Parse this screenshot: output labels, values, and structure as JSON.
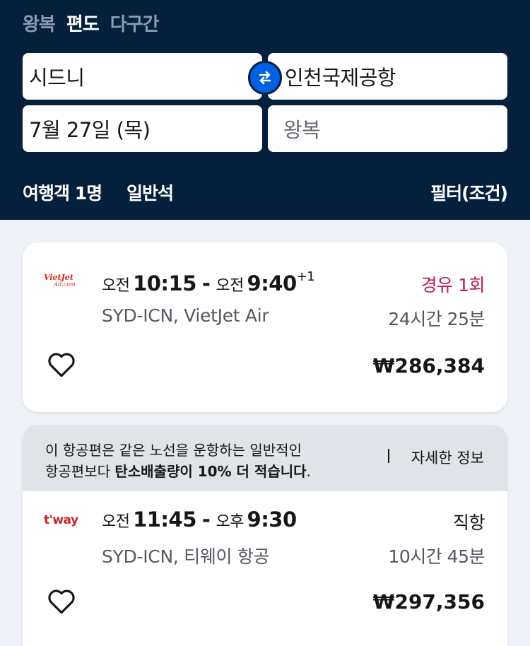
{
  "trip_tabs": [
    "왕복",
    "편도",
    "다구간"
  ],
  "search": {
    "from": "시드니",
    "to": "인천국제공항",
    "depart": "7월 27일 (목)",
    "return_placeholder": "왕복"
  },
  "options": {
    "travellers": "여행객 1명",
    "cabin": "일반석",
    "filters": "필터(조건)"
  },
  "results": [
    {
      "airline_logo_text": [
        "VietJet",
        "Air.com"
      ],
      "depart_ampm": "오전",
      "depart_time": "10:15",
      "arrive_ampm": "오전",
      "arrive_time": "9:40",
      "day_offset": "+1",
      "route": "SYD-ICN, VietJet Air",
      "stops": "경유 1회",
      "duration": "24시간 25분",
      "price": "₩286,384"
    },
    {
      "eco_line1": "이 항공편은 같은 노선을 운항하는 일반적인",
      "eco_line2_prefix": "항공편보다 ",
      "eco_line2_bold": "탄소배출량이 10% 더 적습니다",
      "eco_line2_suffix": ".",
      "eco_link": "자세한 정보",
      "airline_logo_text": "t'way",
      "depart_ampm": "오전",
      "depart_time": "11:45",
      "arrive_ampm": "오후",
      "arrive_time": "9:30",
      "route": "SYD-ICN, 티웨이 항공",
      "stops": "직항",
      "duration": "10시간 45분",
      "price": "₩297,356"
    }
  ],
  "colors": {
    "header_bg": "#05203c",
    "accent_blue": "#0062e3",
    "stops_highlight": "#c2185b"
  }
}
